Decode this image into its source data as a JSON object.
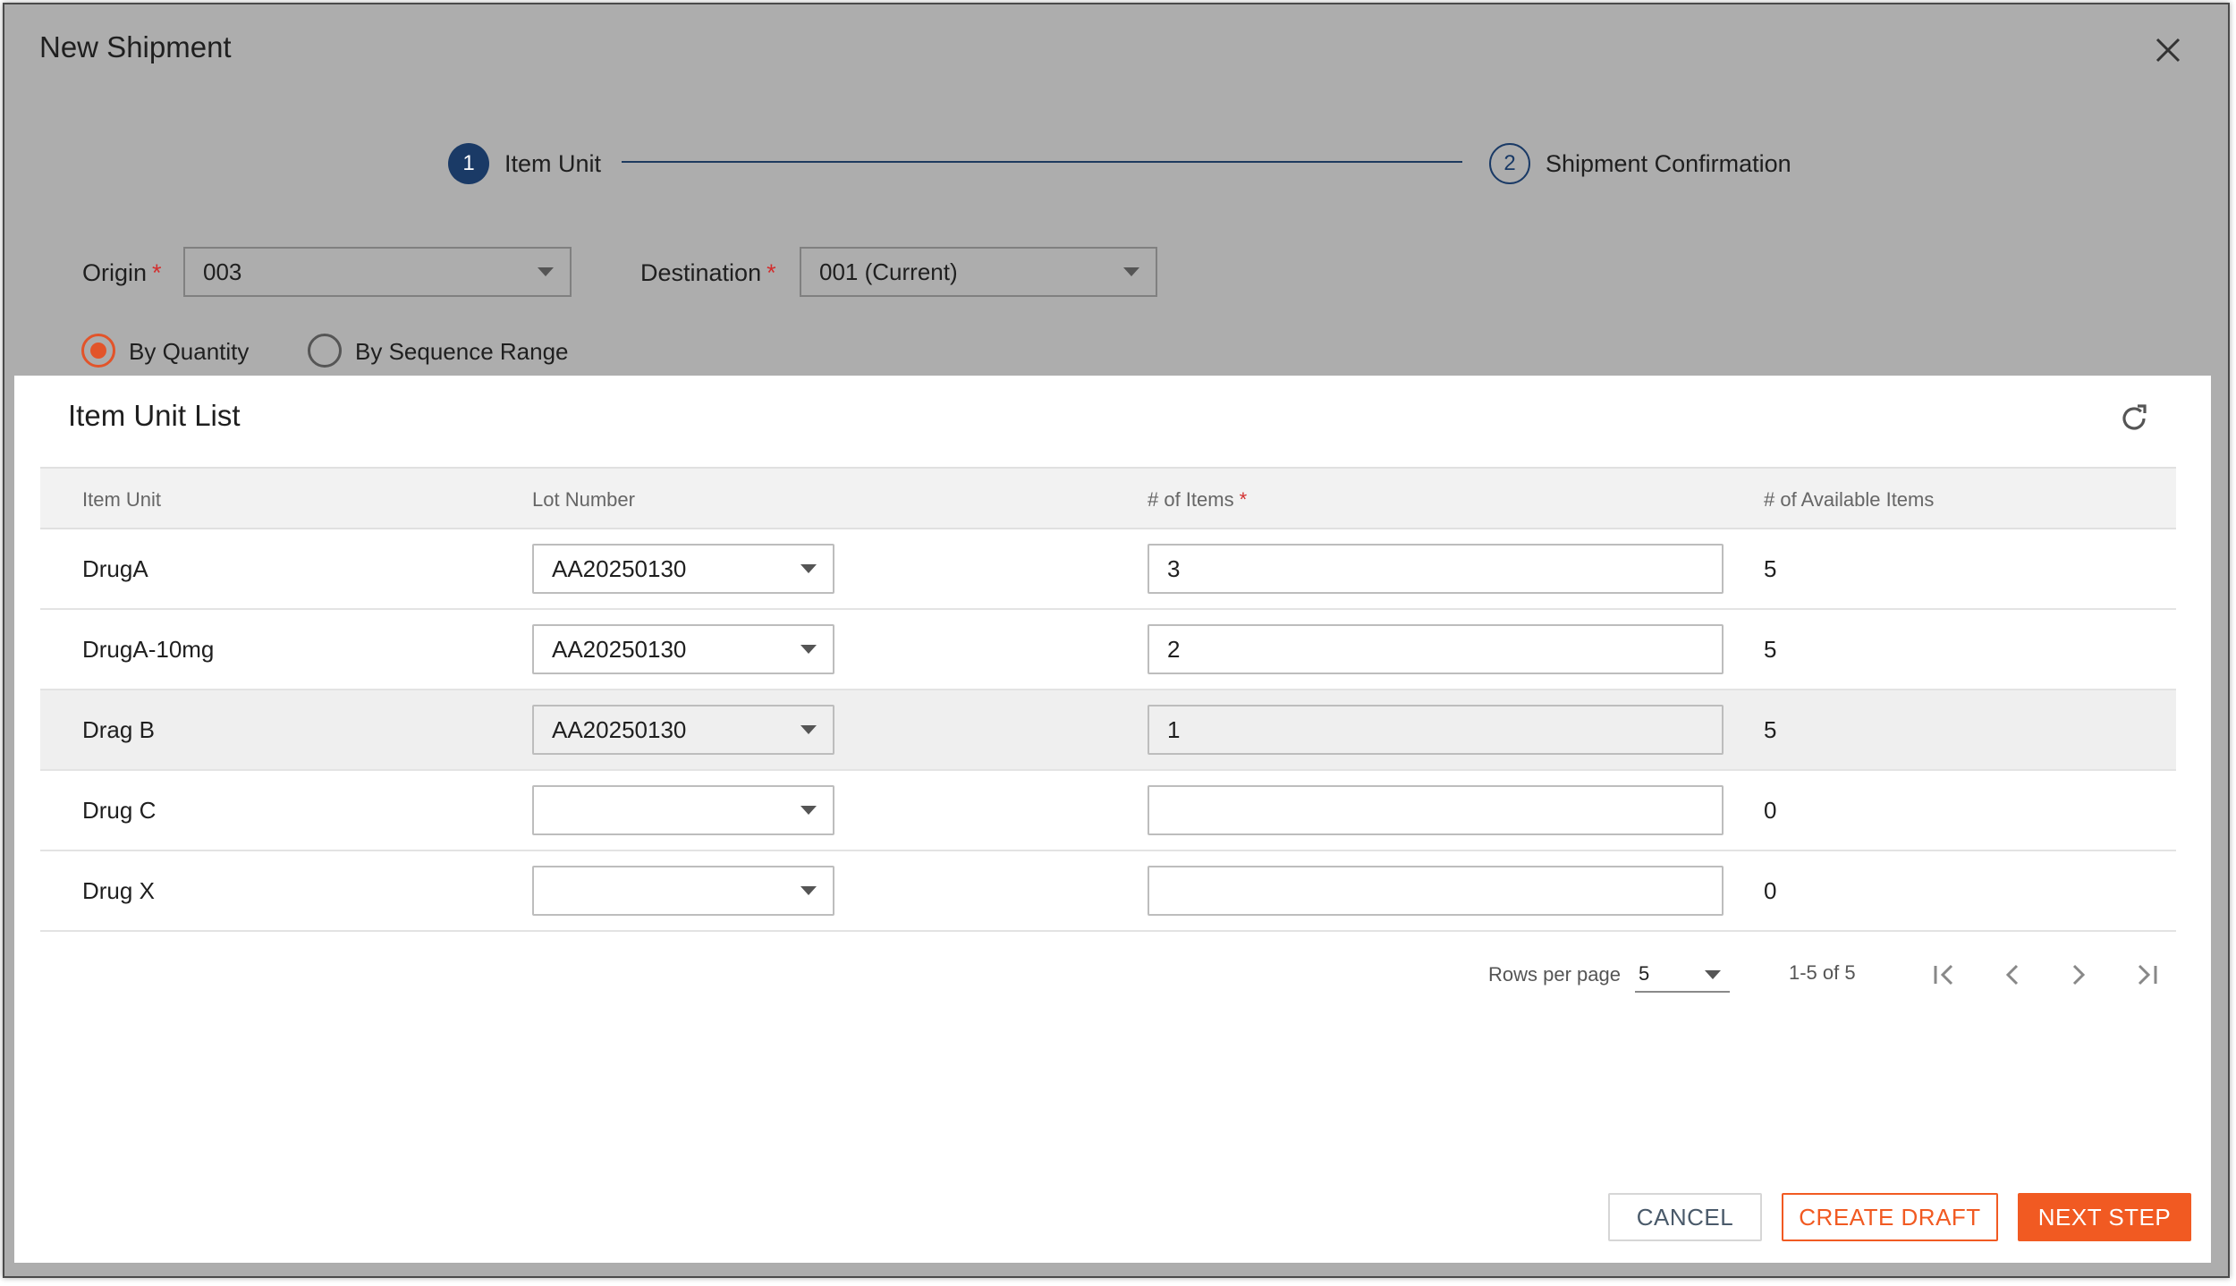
{
  "dialog": {
    "title": "New Shipment"
  },
  "stepper": {
    "steps": [
      {
        "number": "1",
        "label": "Item Unit"
      },
      {
        "number": "2",
        "label": "Shipment Confirmation"
      }
    ]
  },
  "form": {
    "origin_label": "Origin",
    "origin_value": "003",
    "destination_label": "Destination",
    "destination_value": "001 (Current)",
    "required_mark": "*",
    "radio_by_quantity": "By Quantity",
    "radio_by_sequence": "By Sequence Range"
  },
  "item_list": {
    "title": "Item Unit List",
    "columns": [
      "Item Unit",
      "Lot Number",
      "# of Items",
      "# of Available Items"
    ],
    "rows": [
      {
        "item": "DrugA",
        "lot": "AA20250130",
        "qty": "3",
        "available": "5"
      },
      {
        "item": "DrugA-10mg",
        "lot": "AA20250130",
        "qty": "2",
        "available": "5"
      },
      {
        "item": "Drag B",
        "lot": "AA20250130",
        "qty": "1",
        "available": "5"
      },
      {
        "item": "Drug C",
        "lot": "",
        "qty": "",
        "available": "0"
      },
      {
        "item": "Drug X",
        "lot": "",
        "qty": "",
        "available": "0"
      }
    ]
  },
  "pagination": {
    "rows_per_page_label": "Rows per page",
    "rows_per_page_value": "5",
    "range": "1-5 of 5"
  },
  "actions": {
    "cancel": "CANCEL",
    "create_draft": "CREATE DRAFT",
    "next_step": "NEXT STEP"
  },
  "colors": {
    "accent": "#f15a22",
    "step_active": "#1a3a66",
    "required": "#d32f2f"
  }
}
